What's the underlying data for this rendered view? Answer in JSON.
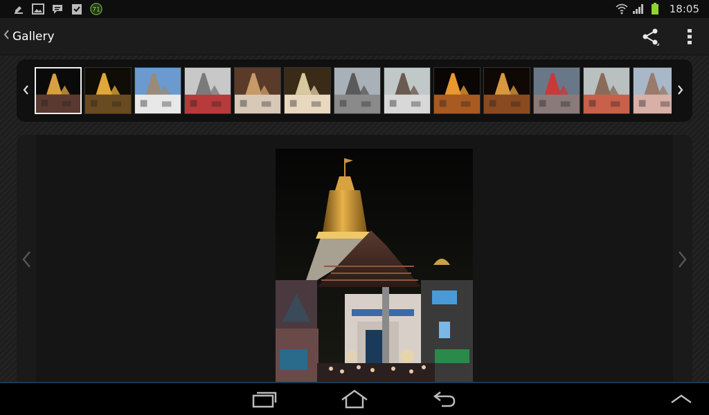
{
  "status_bar": {
    "time": "18:05",
    "left_icons": [
      "usb-debug-icon",
      "image-icon",
      "message-icon",
      "clipboard-check-icon",
      "app-badge-icon"
    ],
    "app_badge_text": "71",
    "right_icons": [
      "wifi-icon",
      "signal-icon",
      "battery-icon"
    ]
  },
  "action_bar": {
    "title": "Gallery",
    "share_icon": "share-icon",
    "menu_icon": "overflow-menu-icon"
  },
  "filmstrip": {
    "selected_index": 0,
    "thumbnails": [
      {
        "name": "temple-night-1"
      },
      {
        "name": "temple-night-gold"
      },
      {
        "name": "temple-day-blue-sky"
      },
      {
        "name": "temple-chariots"
      },
      {
        "name": "deity-shrine"
      },
      {
        "name": "temple-sunset"
      },
      {
        "name": "temple-cloudy"
      },
      {
        "name": "temple-day-trees"
      },
      {
        "name": "temple-night-lit"
      },
      {
        "name": "temple-night-lit-2"
      },
      {
        "name": "rath-yatra-crowd"
      },
      {
        "name": "temple-chariots-2"
      },
      {
        "name": "temple-street"
      }
    ]
  },
  "viewer": {
    "image_name": "jagannath-temple-night"
  },
  "nav_bar": {
    "recent_icon": "recent-apps-icon",
    "home_icon": "home-icon",
    "back_icon": "back-icon",
    "up_icon": "chevron-up-icon"
  }
}
